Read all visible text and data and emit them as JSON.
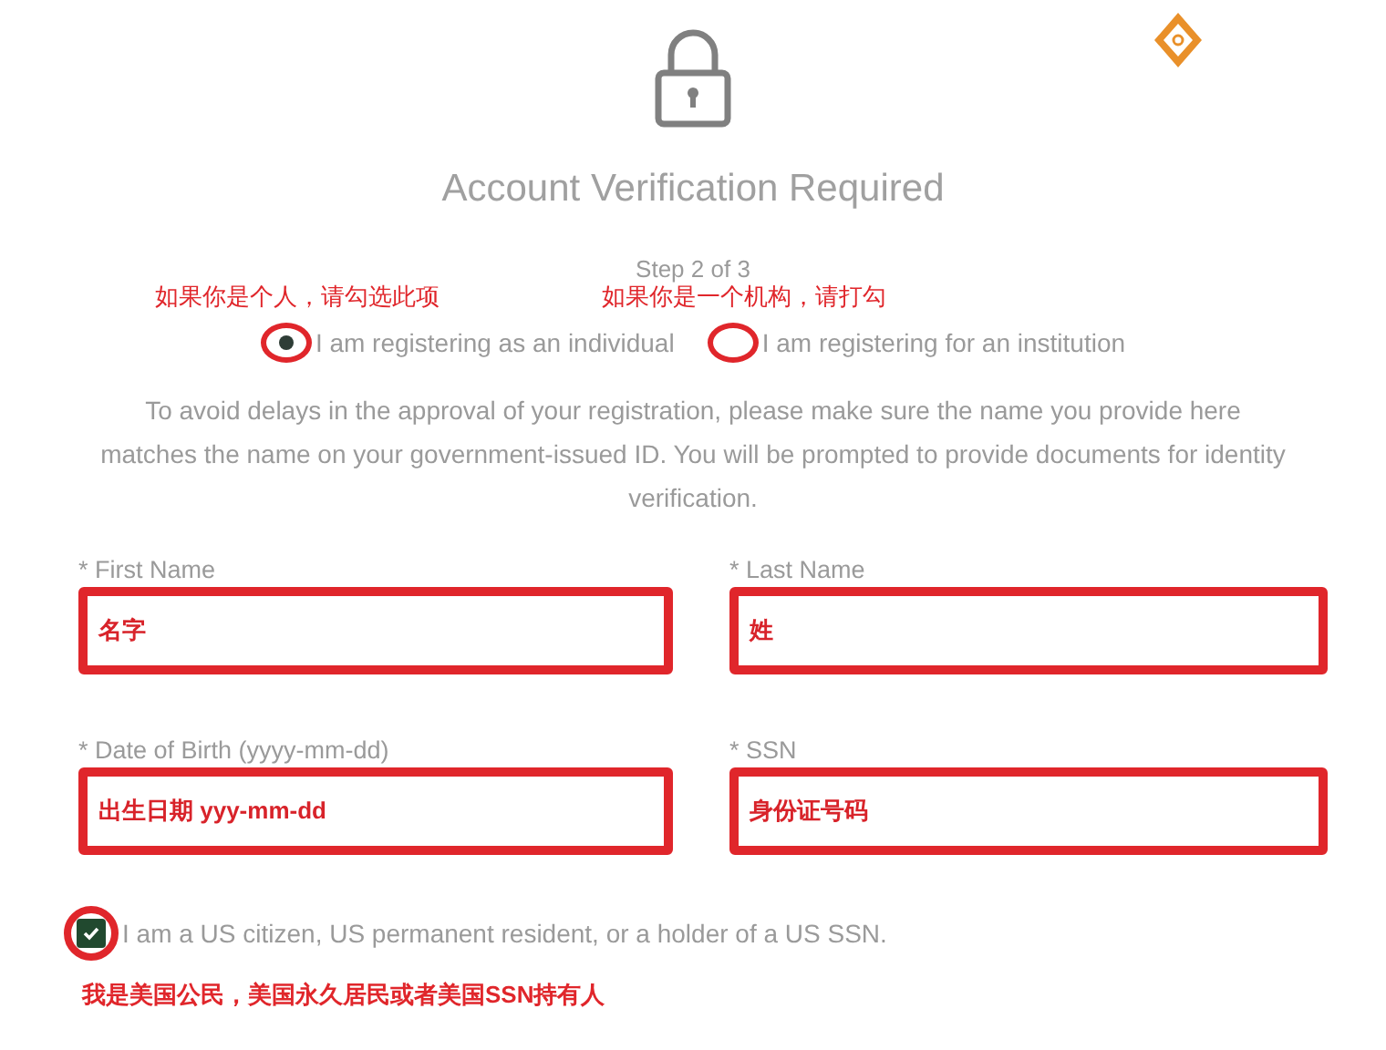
{
  "title": "Account Verification Required",
  "step": "Step 2 of 3",
  "account_types": [
    {
      "note": "如果你是个人，请勾选此项",
      "label": "I am registering as an individual",
      "selected": true
    },
    {
      "note": "如果你是一个机构，请打勾",
      "label": "I am registering for an institution",
      "selected": false
    }
  ],
  "notice": "To avoid delays in the approval of your registration, please make sure the name you provide here matches the name on your government-issued ID. You will be prompted to provide documents for identity verification.",
  "fields": [
    {
      "label": "* First Name",
      "value": "名字"
    },
    {
      "label": "* Last Name",
      "value": "姓"
    },
    {
      "label": "* Date of Birth (yyyy-mm-dd)",
      "value": "出生日期   yyy-mm-dd"
    },
    {
      "label": "* SSN",
      "value": "身份证号码"
    }
  ],
  "citizen": {
    "label": "I am a US citizen, US permanent resident, or a holder of a US SSN.",
    "checked": true,
    "note": "我是美国公民，美国永久居民或者美国SSN持有人"
  }
}
